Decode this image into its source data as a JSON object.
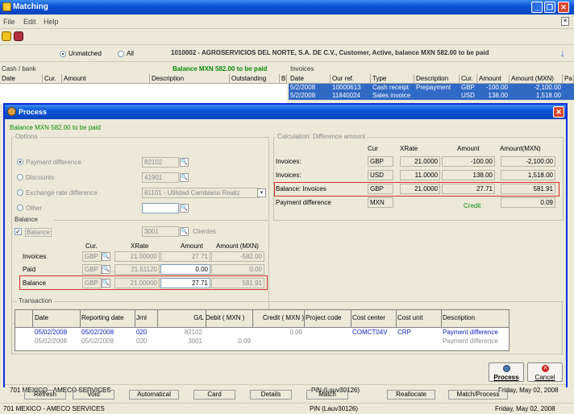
{
  "window": {
    "title": "Matching"
  },
  "menu": [
    "File",
    "Edit",
    "Help"
  ],
  "filter": {
    "unmatched": "Unmatched",
    "all": "All",
    "header": "1010002 - AGROSERVICIOS DEL NORTE, S.A. DE C.V., Customer, Active, balance MXN 582.00 to be paid"
  },
  "cashbank": {
    "title": "Cash / bank",
    "balance": "Balance MXN 582.00 to be paid",
    "columns": [
      "Date",
      "Cur.",
      "Amount",
      "Description",
      "Outstanding",
      "B"
    ]
  },
  "invoices_panel": {
    "title": "Invoices",
    "columns": [
      "Date",
      "Our ref.",
      "Type",
      "Description",
      "Cur.",
      "Amount",
      "Amount (MXN)",
      "Pa"
    ],
    "rows": [
      [
        "5/2/2008",
        "10000613",
        "Cash receipt",
        "Prepayment",
        "GBP",
        "-100.00",
        "-2,100.00",
        ""
      ],
      [
        "5/2/2008",
        "11840024",
        "Sales invoice",
        "",
        "USD",
        "138.00",
        "1,518.00",
        ""
      ]
    ]
  },
  "dialog": {
    "title": "Process",
    "balance_text": "Balance MXN 582.00 to be paid",
    "options": {
      "legend": "Options",
      "payment_difference": "Payment difference",
      "payment_difference_code": "82102",
      "discounts": "Discounts",
      "discounts_code": "41901",
      "exchange_rate_difference": "Exchange rate difference",
      "exchange_rate_value": "81101 - Utilidad Cambiaria Realiz",
      "other": "Other",
      "other_value": ""
    },
    "balance_section": {
      "legend": "Balance",
      "checkbox_label": "Balance",
      "code": "3001",
      "code_desc": "Clientes",
      "col_cur": "Cur.",
      "col_xrate": "XRate",
      "col_amount": "Amount",
      "col_amount_mxn": "Amount (MXN)",
      "rows": [
        {
          "label": "Invoices",
          "cur": "GBP",
          "xrate": "21.00000",
          "amount": "27.71",
          "amount_mxn": "-582.00"
        },
        {
          "label": "Paid",
          "cur": "GBP",
          "xrate": "21.51120",
          "amount": "0.00",
          "amount_mxn": "0.00"
        },
        {
          "label": "Balance",
          "cur": "GBP",
          "xrate": "21.00000",
          "amount": "27.71",
          "amount_mxn": "581.91"
        }
      ]
    },
    "calc": {
      "legend": "Calculation: Difference amount",
      "col_cur": "Cur",
      "col_xrate": "XRate",
      "col_amount": "Amount",
      "col_amount_mxn": "Amount(MXN)",
      "rows": [
        {
          "label": "Invoices:",
          "cur": "GBP",
          "xrate": "21.0000",
          "amount": "-100.00",
          "amount_mxn": "-2,100.00"
        },
        {
          "label": "Invoices:",
          "cur": "USD",
          "xrate": "11.0000",
          "amount": "138.00",
          "amount_mxn": "1,518.00"
        },
        {
          "label": "Balance: Invoices",
          "cur": "GBP",
          "xrate": "21.0000",
          "amount": "27.71",
          "amount_mxn": "581.91"
        }
      ],
      "payment_difference_label": "Payment difference",
      "payment_difference_cur": "MXN",
      "credit_label": "Credit",
      "payment_difference_amount": "0.09"
    },
    "transaction": {
      "legend": "Transaction",
      "columns": [
        "Date",
        "Reporting date",
        "Jrnl",
        "G/L",
        "Debit ( MXN )",
        "Credit ( MXN )",
        "Project code",
        "Cost center",
        "Cost unit",
        "Description"
      ],
      "rows": [
        [
          "05/02/2008",
          "05/02/2008",
          "020",
          "82102",
          "",
          "0.09",
          "",
          "COMCT04V",
          "CRP",
          "Payment difference"
        ],
        [
          "05/02/2008",
          "05/02/2008",
          "020",
          "3001",
          "0.09",
          "",
          "",
          "",
          "",
          "Payment difference"
        ]
      ]
    },
    "process_button": "Process",
    "cancel_button": "Cancel"
  },
  "status": {
    "company": "701 MEXICO - AMECO SERVICES",
    "user": "PiN (Lauv30126)",
    "date": "Friday, May 02, 2008"
  },
  "bottom_buttons": [
    "Refresh",
    "Void",
    "Automatical",
    "Card",
    "Details",
    "Match",
    "Reallocate",
    "Match/Process"
  ]
}
